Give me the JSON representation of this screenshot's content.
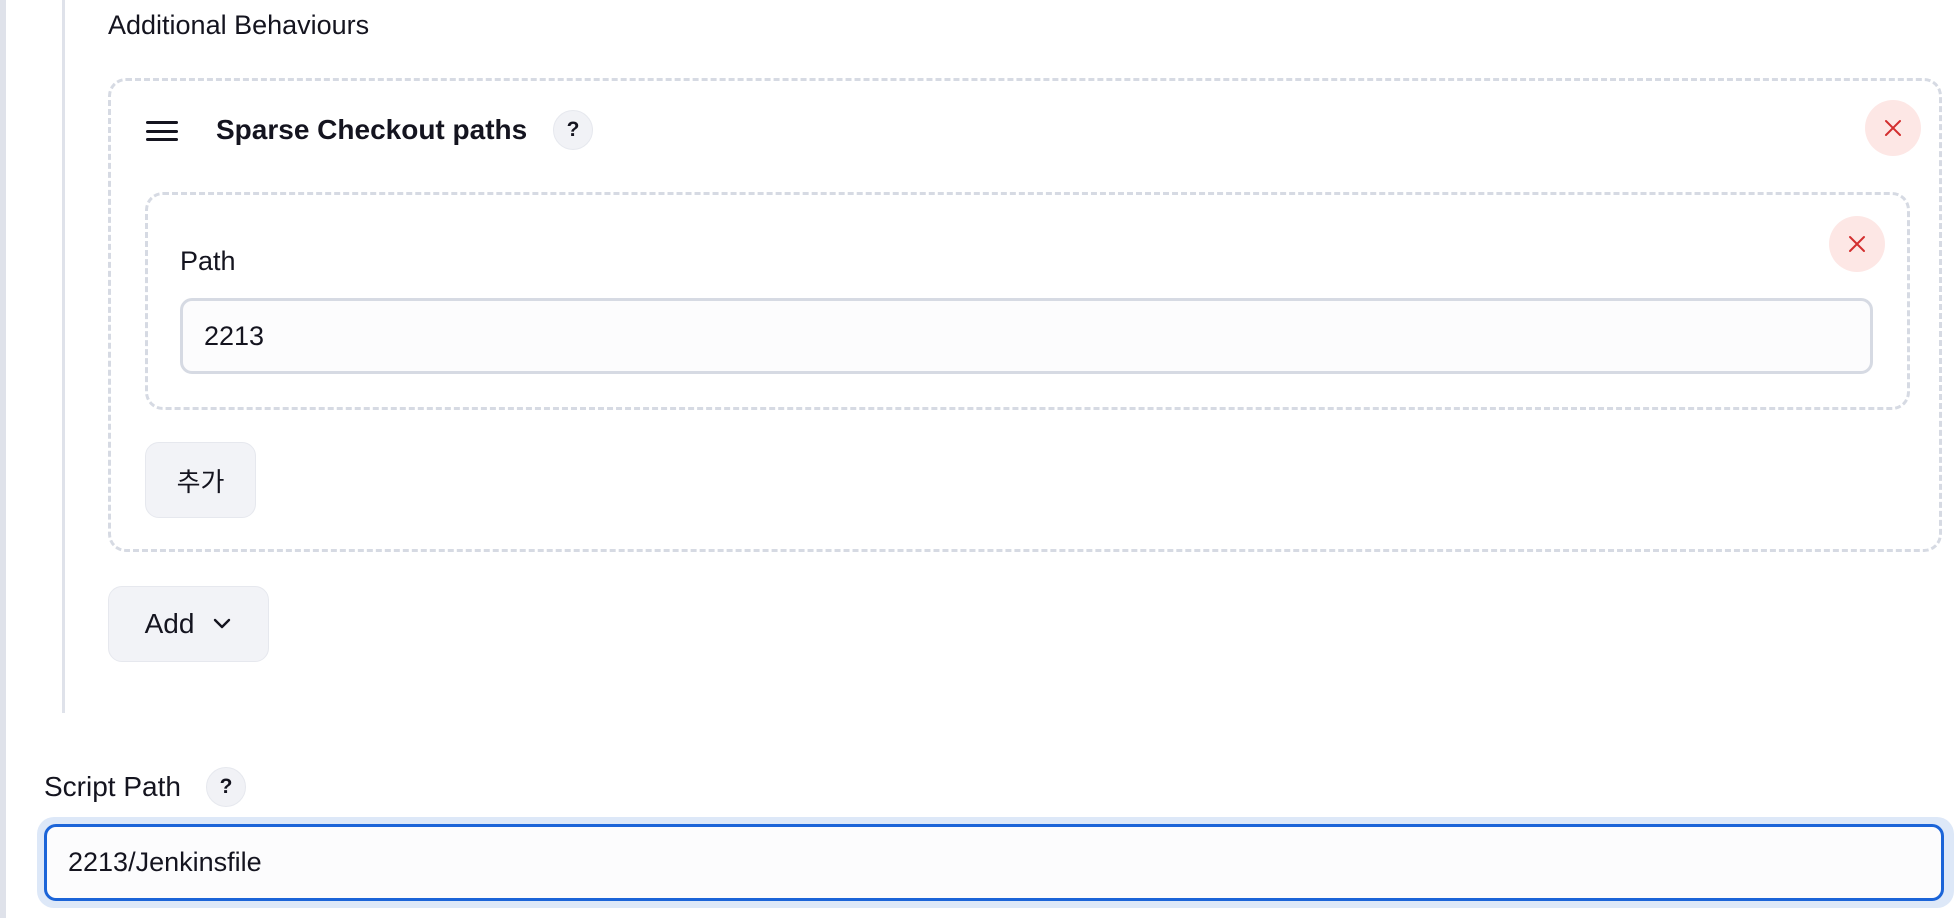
{
  "additional_behaviours": {
    "title": "Additional Behaviours",
    "sparse_checkout": {
      "title": "Sparse Checkout paths",
      "help_label": "?",
      "path": {
        "label": "Path",
        "value": "2213"
      },
      "add_path_label": "추가"
    },
    "add_label": "Add"
  },
  "script_path": {
    "label": "Script Path",
    "help_label": "?",
    "value": "2213/Jenkinsfile"
  },
  "icons": {
    "drag": "menu-lines-icon",
    "close": "close-x-icon",
    "dropdown": "chevron-down-icon"
  },
  "colors": {
    "accent": "#1b64d8",
    "danger": "#d32f2f",
    "danger_bg": "#fde7e5",
    "border": "#d6dae3"
  }
}
